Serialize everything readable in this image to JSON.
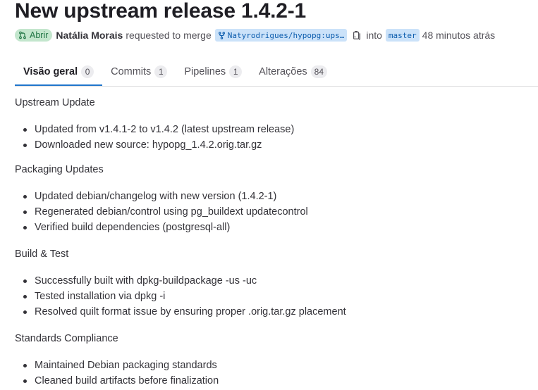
{
  "header": {
    "title": "New upstream release 1.4.2-1",
    "status": "Abrir",
    "author": "Natália Morais",
    "requested_text": "requested to merge",
    "source_branch": "Natyrodrigues/hypopg:ups…",
    "into_text": "into",
    "target_branch": "master",
    "time_ago": "48 minutos atrás"
  },
  "tabs": [
    {
      "label": "Visão geral",
      "count": "0"
    },
    {
      "label": "Commits",
      "count": "1"
    },
    {
      "label": "Pipelines",
      "count": "1"
    },
    {
      "label": "Alterações",
      "count": "84"
    }
  ],
  "sections": [
    {
      "heading": "Upstream Update",
      "items": [
        "Updated from v1.4.1-2 to v1.4.2 (latest upstream release)",
        "Downloaded new source: hypopg_1.4.2.orig.tar.gz"
      ]
    },
    {
      "heading": "Packaging Updates",
      "items": [
        "Updated debian/changelog with new version (1.4.2-1)",
        "Regenerated debian/control using pg_buildext updatecontrol",
        "Verified build dependencies (postgresql-all)"
      ]
    },
    {
      "heading": "Build & Test",
      "items": [
        "Successfully built with dpkg-buildpackage -us -uc",
        "Tested installation via dpkg -i",
        "Resolved quilt format issue by ensuring proper .orig.tar.gz placement"
      ]
    },
    {
      "heading": "Standards Compliance",
      "items": [
        "Maintained Debian packaging standards",
        "Cleaned build artifacts before finalization"
      ]
    }
  ],
  "icons": {
    "status": "merge-request-icon",
    "branch": "branch-fork-icon",
    "copy": "copy-clipboard-icon"
  },
  "colors": {
    "status_bg": "#c3e6cd",
    "status_fg": "#217645",
    "branch_bg": "#cbe2f9",
    "branch_fg": "#0b5cad",
    "tab_active_underline": "#1f75cb"
  }
}
